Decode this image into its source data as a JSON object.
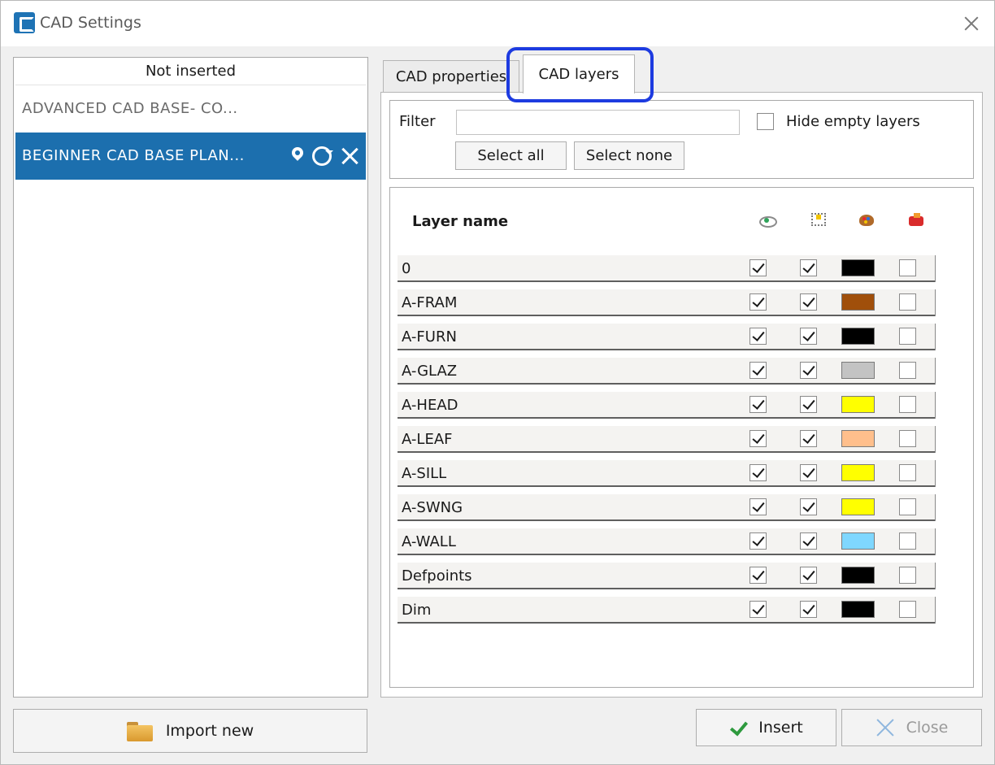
{
  "window": {
    "title": "CAD Settings"
  },
  "left_panel": {
    "header": "Not inserted",
    "items": [
      {
        "label": "ADVANCED CAD BASE- CO..."
      },
      {
        "label": "BEGINNER CAD BASE PLAN..."
      }
    ],
    "selected_index": 1,
    "import_button": "Import new"
  },
  "tabs": [
    {
      "label": "CAD properties"
    },
    {
      "label": "CAD layers"
    }
  ],
  "active_tab": 1,
  "filter": {
    "label": "Filter",
    "value": "",
    "hide_empty_label": "Hide empty layers",
    "hide_empty_checked": false,
    "select_all": "Select all",
    "select_none": "Select none"
  },
  "layers": {
    "column_header": "Layer name",
    "column_icons": [
      "eye-icon",
      "cursor-select-icon",
      "palette-icon",
      "print-icon"
    ],
    "rows": [
      {
        "name": "0",
        "visible": true,
        "selectable": true,
        "color": "#000000",
        "print": false
      },
      {
        "name": "A-FRAM",
        "visible": true,
        "selectable": true,
        "color": "#a04f0b",
        "print": false
      },
      {
        "name": "A-FURN",
        "visible": true,
        "selectable": true,
        "color": "#000000",
        "print": false
      },
      {
        "name": "A-GLAZ",
        "visible": true,
        "selectable": true,
        "color": "#c3c3c3",
        "print": false
      },
      {
        "name": "A-HEAD",
        "visible": true,
        "selectable": true,
        "color": "#ffff00",
        "print": false
      },
      {
        "name": "A-LEAF",
        "visible": true,
        "selectable": true,
        "color": "#ffbf8c",
        "print": false
      },
      {
        "name": "A-SILL",
        "visible": true,
        "selectable": true,
        "color": "#ffff00",
        "print": false
      },
      {
        "name": "A-SWNG",
        "visible": true,
        "selectable": true,
        "color": "#ffff00",
        "print": false
      },
      {
        "name": "A-WALL",
        "visible": true,
        "selectable": true,
        "color": "#7fd7ff",
        "print": false
      },
      {
        "name": "Defpoints",
        "visible": true,
        "selectable": true,
        "color": "#000000",
        "print": false
      },
      {
        "name": "Dim",
        "visible": true,
        "selectable": true,
        "color": "#000000",
        "print": false
      }
    ]
  },
  "footer": {
    "insert": "Insert",
    "close": "Close"
  },
  "colors": {
    "selection": "#1c6fae",
    "highlight": "#1d3be0"
  }
}
